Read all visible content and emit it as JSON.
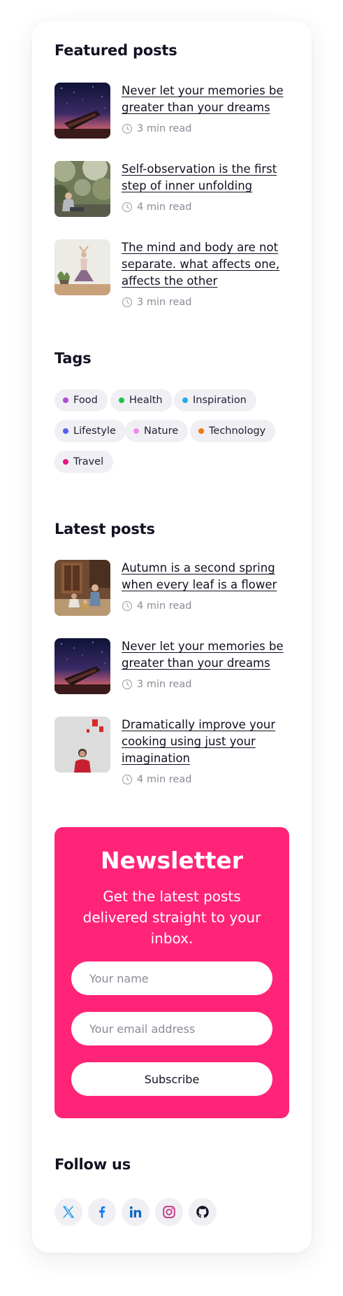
{
  "featured": {
    "title": "Featured posts",
    "posts": [
      {
        "title": "Never let your memories be greater than your dreams",
        "read_time": "3 min read",
        "image": "boat-under-night-sky"
      },
      {
        "title": "Self-observation is the first step of inner unfolding",
        "read_time": "4 min read",
        "image": "person-sitting-in-forest"
      },
      {
        "title": "The mind and body are not separate. what affects one, affects the other",
        "read_time": "3 min read",
        "image": "woman-doing-yoga"
      }
    ]
  },
  "tags": {
    "title": "Tags",
    "items": [
      {
        "label": "Food",
        "color": "#b04ad8"
      },
      {
        "label": "Health",
        "color": "#1fc44a"
      },
      {
        "label": "Inspiration",
        "color": "#1bb0e8"
      },
      {
        "label": "Lifestyle",
        "color": "#5560ee"
      },
      {
        "label": "Nature",
        "color": "#f08cf0"
      },
      {
        "label": "Technology",
        "color": "#f07a10"
      },
      {
        "label": "Travel",
        "color": "#e8167e"
      }
    ]
  },
  "latest": {
    "title": "Latest posts",
    "posts": [
      {
        "title": "Autumn is a second spring when every leaf is a flower",
        "read_time": "4 min read",
        "image": "family-in-living-room"
      },
      {
        "title": "Never let your memories be greater than your dreams",
        "read_time": "3 min read",
        "image": "boat-under-night-sky"
      },
      {
        "title": "Dramatically improve your cooking using just your imagination",
        "read_time": "4 min read",
        "image": "woman-against-white-wall"
      }
    ]
  },
  "newsletter": {
    "title": "Newsletter",
    "description": "Get the latest posts delivered straight to your inbox.",
    "name_placeholder": "Your name",
    "email_placeholder": "Your email address",
    "button_label": "Subscribe",
    "background_color": "#ff2478"
  },
  "follow": {
    "title": "Follow us",
    "icons": [
      "x-twitter-icon",
      "facebook-icon",
      "linkedin-icon",
      "instagram-icon",
      "github-icon"
    ]
  }
}
